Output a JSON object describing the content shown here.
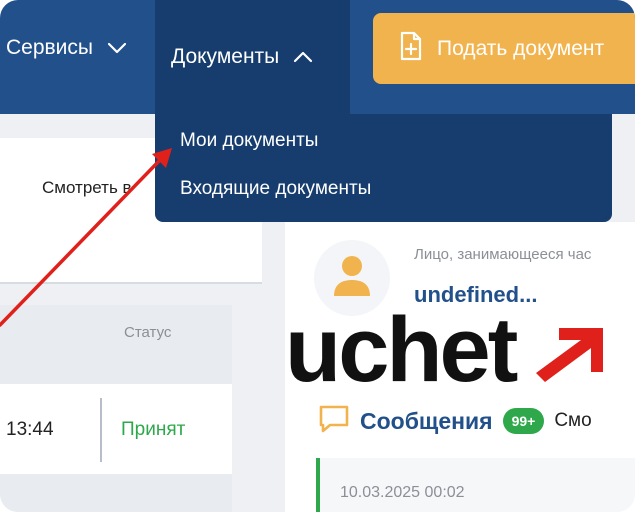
{
  "nav": {
    "services_label": "Сервисы",
    "documents_label": "Документы",
    "submit_label": "Подать документ"
  },
  "dropdown": {
    "items": [
      {
        "label": "Мои документы"
      },
      {
        "label": "Входящие документы"
      }
    ]
  },
  "left_panel": {
    "view_link": "Смотреть в",
    "status_header": "Статус",
    "row": {
      "time": "13:44",
      "status": "Принят"
    }
  },
  "profile": {
    "role": "Лицо, занимающееся час",
    "name": "undefined..."
  },
  "messages": {
    "title": "Сообщения",
    "count_badge": "99+",
    "view_link": "Смо",
    "first_date": "10.03.2025 00:02"
  },
  "logo": {
    "text": "uchet"
  },
  "colors": {
    "nav_bg": "#22508a",
    "dropdown_bg": "#163d6e",
    "accent_orange": "#f1b34d",
    "success_green": "#2ea84a",
    "arrow_red": "#e0201b"
  },
  "icons": {
    "chevron": "chevron-down-icon",
    "chevron_up": "chevron-up-icon",
    "file_add": "file-plus-icon",
    "user": "user-icon",
    "chat": "chat-icon"
  }
}
